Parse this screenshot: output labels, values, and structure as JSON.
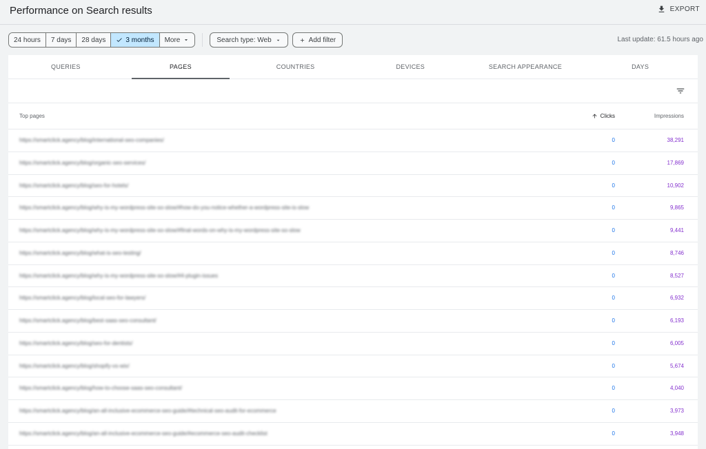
{
  "header": {
    "title": "Performance on Search results",
    "export_label": "EXPORT"
  },
  "date_range": {
    "options": [
      {
        "label": "24 hours",
        "selected": false
      },
      {
        "label": "7 days",
        "selected": false
      },
      {
        "label": "28 days",
        "selected": false
      },
      {
        "label": "3 months",
        "selected": true
      },
      {
        "label": "More",
        "selected": false
      }
    ]
  },
  "filters": {
    "search_type": "Search type: Web",
    "add_filter": "Add filter"
  },
  "last_update": "Last update: 61.5 hours ago",
  "tabs": [
    {
      "label": "QUERIES",
      "active": false
    },
    {
      "label": "PAGES",
      "active": true
    },
    {
      "label": "COUNTRIES",
      "active": false
    },
    {
      "label": "DEVICES",
      "active": false
    },
    {
      "label": "SEARCH APPEARANCE",
      "active": false
    },
    {
      "label": "DAYS",
      "active": false
    }
  ],
  "table": {
    "headers": {
      "pages": "Top pages",
      "clicks": "Clicks",
      "impressions": "Impressions"
    },
    "rows": [
      {
        "url": "https://smartclick.agency/blog/international-seo-companies/",
        "clicks": "0",
        "impressions": "38,291"
      },
      {
        "url": "https://smartclick.agency/blog/organic-seo-services/",
        "clicks": "0",
        "impressions": "17,869"
      },
      {
        "url": "https://smartclick.agency/blog/seo-for-hotels/",
        "clicks": "0",
        "impressions": "10,902"
      },
      {
        "url": "https://smartclick.agency/blog/why-is-my-wordpress-site-so-slow/#how-do-you-notice-whether-a-wordpress-site-is-slow",
        "clicks": "0",
        "impressions": "9,865"
      },
      {
        "url": "https://smartclick.agency/blog/why-is-my-wordpress-site-so-slow/#final-words-on-why-is-my-wordpress-site-so-slow",
        "clicks": "0",
        "impressions": "9,441"
      },
      {
        "url": "https://smartclick.agency/blog/what-is-seo-testing/",
        "clicks": "0",
        "impressions": "8,746"
      },
      {
        "url": "https://smartclick.agency/blog/why-is-my-wordpress-site-so-slow/#4-plugin-issues",
        "clicks": "0",
        "impressions": "8,527"
      },
      {
        "url": "https://smartclick.agency/blog/local-seo-for-lawyers/",
        "clicks": "0",
        "impressions": "6,932"
      },
      {
        "url": "https://smartclick.agency/blog/best-saas-seo-consultant/",
        "clicks": "0",
        "impressions": "6,193"
      },
      {
        "url": "https://smartclick.agency/blog/seo-for-dentists/",
        "clicks": "0",
        "impressions": "6,005"
      },
      {
        "url": "https://smartclick.agency/blog/shopify-vs-wix/",
        "clicks": "0",
        "impressions": "5,674"
      },
      {
        "url": "https://smartclick.agency/blog/how-to-choose-saas-seo-consultant/",
        "clicks": "0",
        "impressions": "4,040"
      },
      {
        "url": "https://smartclick.agency/blog/an-all-inclusive-ecommerce-seo-guide/#technical-seo-audit-for-ecommerce",
        "clicks": "0",
        "impressions": "3,973"
      },
      {
        "url": "https://smartclick.agency/blog/an-all-inclusive-ecommerce-seo-guide/#ecommerce-seo-audit-checklist",
        "clicks": "0",
        "impressions": "3,948"
      }
    ]
  },
  "icons": {
    "export": "download-icon",
    "check": "check-icon",
    "dropdown": "caret-down-icon",
    "add": "plus-icon",
    "filter_rows": "filter-list-icon",
    "sort": "arrow-up-icon"
  },
  "colors": {
    "selected_chip": "#c2e7ff",
    "clicks": "#1a73e8",
    "impressions": "#8430ce"
  }
}
